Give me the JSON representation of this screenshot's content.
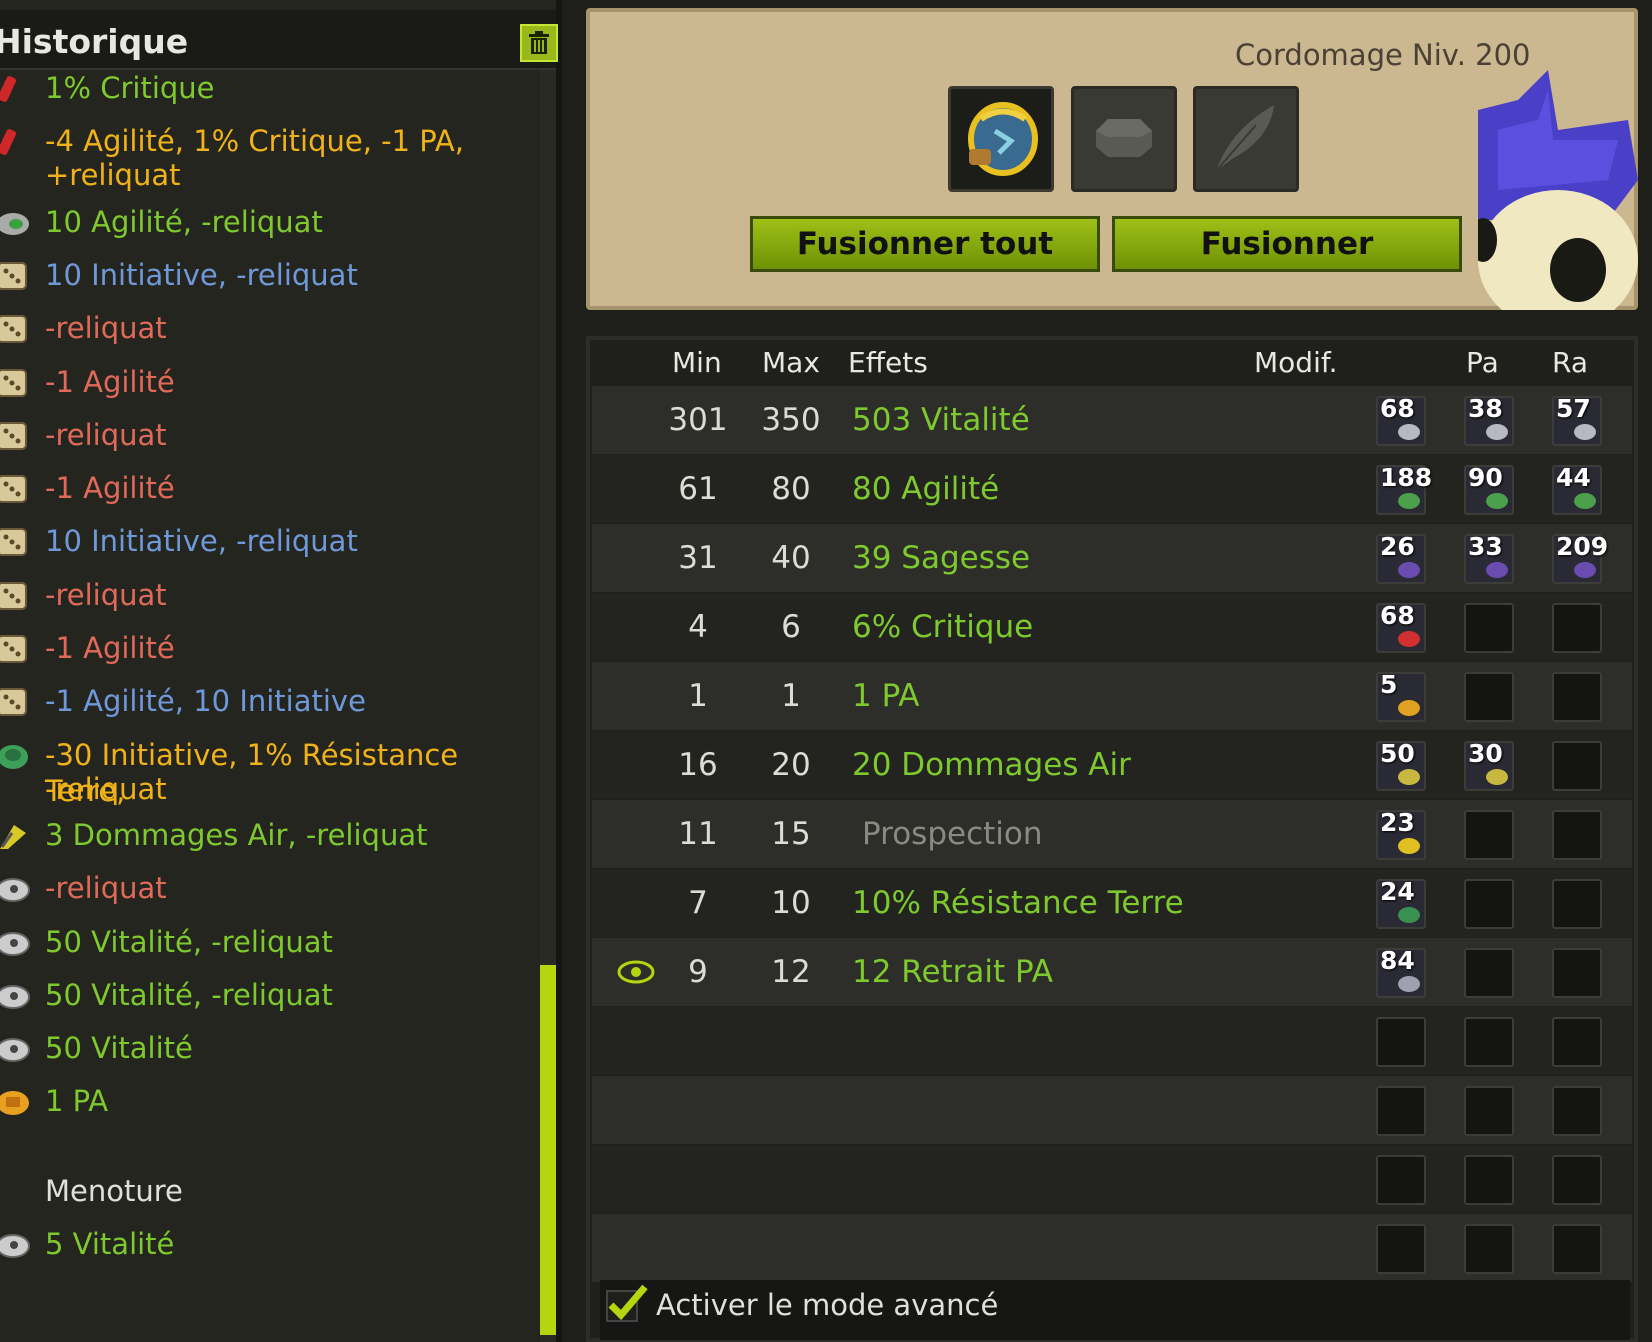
{
  "history": {
    "title": "Historique",
    "entries": [
      {
        "text": "1% Critique",
        "color": "green",
        "icon": "critique-rune-icon"
      },
      {
        "text": "-4 Agilité, 1% Critique, -1 PA,",
        "text2": "+reliquat",
        "color": "orange",
        "icon": "critique-rune-icon"
      },
      {
        "text": "10 Agilité, -reliquat",
        "color": "green",
        "icon": "agilite-rune-icon"
      },
      {
        "text": "10 Initiative, -reliquat",
        "color": "blue",
        "icon": "dice-icon"
      },
      {
        "text": "-reliquat",
        "color": "red",
        "icon": "dice-icon"
      },
      {
        "text": "-1 Agilité",
        "color": "red",
        "icon": "dice-icon"
      },
      {
        "text": "-reliquat",
        "color": "red",
        "icon": "dice-icon"
      },
      {
        "text": "-1 Agilité",
        "color": "red",
        "icon": "dice-icon"
      },
      {
        "text": "10 Initiative, -reliquat",
        "color": "blue",
        "icon": "dice-icon"
      },
      {
        "text": "-reliquat",
        "color": "red",
        "icon": "dice-icon"
      },
      {
        "text": "-1 Agilité",
        "color": "red",
        "icon": "dice-icon"
      },
      {
        "text": "-1 Agilité, 10 Initiative",
        "color": "blue",
        "icon": "dice-icon"
      },
      {
        "text": "-30 Initiative, 1% Résistance Terre,",
        "text2": "-reliquat",
        "color": "orange",
        "icon": "terre-rune-icon"
      },
      {
        "text": "3 Dommages Air, -reliquat",
        "color": "green",
        "icon": "air-rune-icon"
      },
      {
        "text": "-reliquat",
        "color": "red",
        "icon": "vitalite-rune-icon"
      },
      {
        "text": "50 Vitalité, -reliquat",
        "color": "green",
        "icon": "vitalite-rune-icon"
      },
      {
        "text": "50 Vitalité, -reliquat",
        "color": "green",
        "icon": "vitalite-rune-icon"
      },
      {
        "text": "50 Vitalité",
        "color": "green",
        "icon": "vitalite-rune-icon"
      },
      {
        "text": "1 PA",
        "color": "green",
        "icon": "pa-rune-icon"
      }
    ],
    "section": "Menoture",
    "section_entry": {
      "text": "5 Vitalité",
      "color": "green",
      "icon": "vitalite-rune-icon"
    }
  },
  "workshop": {
    "job_title": "Cordomage Niv. 200",
    "fuse_all_label": "Fusionner tout",
    "fuse_label": "Fusionner"
  },
  "table": {
    "headers": {
      "min": "Min",
      "max": "Max",
      "effects": "Effets",
      "modif": "Modif.",
      "pa": "Pa",
      "ra": "Ra"
    },
    "rows": [
      {
        "min": "301",
        "max": "350",
        "effect": "503 Vitalité",
        "runes": [
          "68",
          "38",
          "57"
        ],
        "rune_color": "#b8b8c0"
      },
      {
        "min": "61",
        "max": "80",
        "effect": "80 Agilité",
        "runes": [
          "188",
          "90",
          "44"
        ],
        "rune_color": "#4ca04c"
      },
      {
        "min": "31",
        "max": "40",
        "effect": "39 Sagesse",
        "runes": [
          "26",
          "33",
          "209"
        ],
        "rune_color": "#6a4cb0"
      },
      {
        "min": "4",
        "max": "6",
        "effect": "6% Critique",
        "runes": [
          "68",
          "",
          ""
        ],
        "rune_color": "#d03030"
      },
      {
        "min": "1",
        "max": "1",
        "effect": "1 PA",
        "runes": [
          "5",
          "",
          ""
        ],
        "rune_color": "#e0a020"
      },
      {
        "min": "16",
        "max": "20",
        "effect": "20 Dommages Air",
        "runes": [
          "50",
          "30",
          ""
        ],
        "rune_color": "#c8b840"
      },
      {
        "min": "11",
        "max": "15",
        "effect": "Prospection",
        "runes": [
          "23",
          "",
          ""
        ],
        "rune_color": "#e0c020",
        "muted": true
      },
      {
        "min": "7",
        "max": "10",
        "effect": "10% Résistance Terre",
        "runes": [
          "24",
          "",
          ""
        ],
        "rune_color": "#3a9050"
      },
      {
        "min": "9",
        "max": "12",
        "effect": "12 Retrait PA",
        "runes": [
          "84",
          "",
          ""
        ],
        "rune_color": "#a0a0b0",
        "eye": true
      }
    ],
    "empty_rows": 4
  },
  "advanced_mode": {
    "label": "Activer le mode avancé",
    "checked": true
  }
}
